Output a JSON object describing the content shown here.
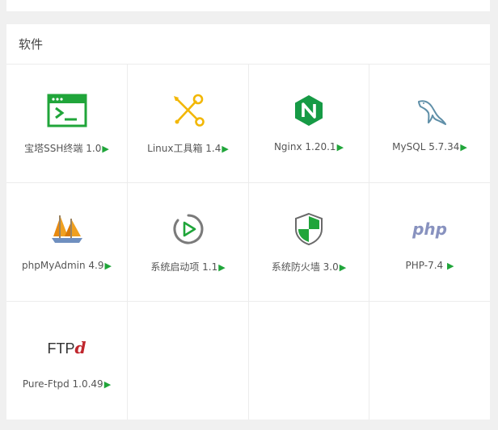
{
  "panel": {
    "title": "软件"
  },
  "accent_color": "#20a53a",
  "arrow_glyph": "▶",
  "items": [
    {
      "name": "宝塔SSH终端 1.0",
      "icon": "terminal-icon"
    },
    {
      "name": "Linux工具箱 1.4",
      "icon": "tools-icon"
    },
    {
      "name": "Nginx 1.20.1",
      "icon": "nginx-icon"
    },
    {
      "name": "MySQL 5.7.34",
      "icon": "mysql-dolphin-icon"
    },
    {
      "name": "phpMyAdmin 4.9",
      "icon": "phpmyadmin-sailboat-icon"
    },
    {
      "name": "系统启动项 1.1",
      "icon": "startup-icon"
    },
    {
      "name": "系统防火墙 3.0",
      "icon": "firewall-shield-icon"
    },
    {
      "name": "PHP-7.4 ",
      "icon": "php-icon",
      "logo_text": "php"
    },
    {
      "name": "Pure-Ftpd 1.0.49",
      "icon": "ftpd-icon",
      "logo_text": "FTP",
      "logo_text_suffix": "d"
    }
  ]
}
